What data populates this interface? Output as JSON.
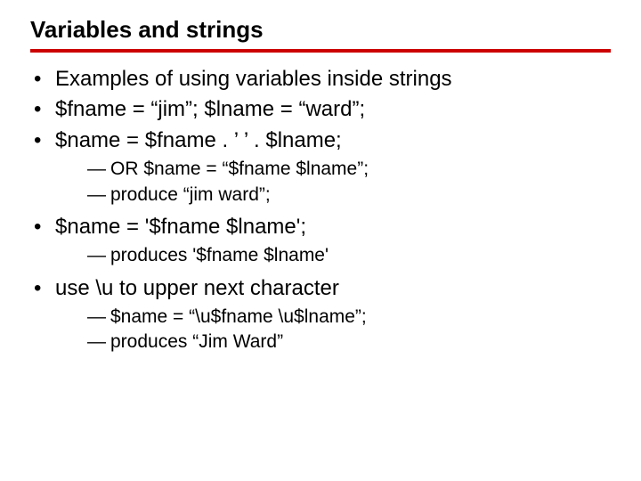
{
  "title": "Variables and strings",
  "bullets": {
    "b0": "Examples of using variables inside strings",
    "b1": "$fname = “jim”; $lname = “ward”;",
    "b2": "$name = $fname . ’ ’ . $lname;",
    "b2_sub": {
      "s0": "OR $name = “$fname $lname”;",
      "s1": "produce “jim ward”;"
    },
    "b3": " $name = '$fname $lname';",
    "b3_sub": {
      "s0": "produces '$fname $lname'"
    },
    "b4": " use \\u to upper next character",
    "b4_sub": {
      "s0": "$name = “\\u$fname \\u$lname”;",
      "s1": "produces “Jim Ward”"
    }
  }
}
